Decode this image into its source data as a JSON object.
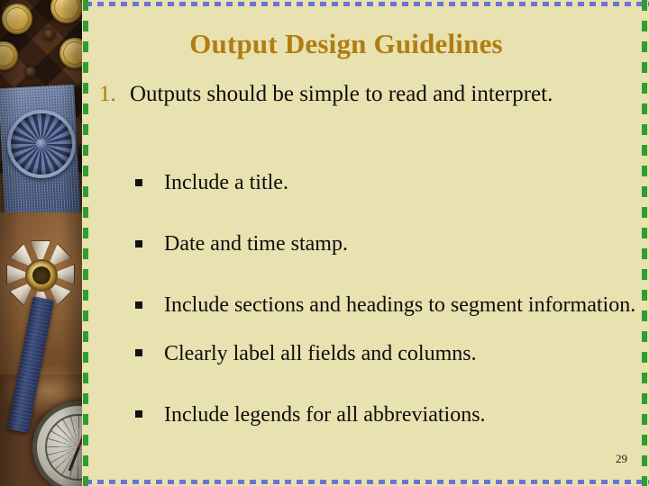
{
  "slide": {
    "title": "Output Design Guidelines",
    "page_number": "29",
    "background_color": "#e8e1b0",
    "title_color": "#b07d11",
    "border_top_color": "#6b72d8",
    "border_bottom_color": "#6b72d8",
    "border_left_color": "#2f9e32",
    "border_right_color": "#2f9e32"
  },
  "numbered_list": [
    {
      "marker": "1.",
      "text": "Outputs should be simple to read and interpret."
    }
  ],
  "bullets": [
    {
      "marker": "▪",
      "text": "Include a title."
    },
    {
      "marker": "▪",
      "text": "Date and time stamp."
    },
    {
      "marker": "▪",
      "text": "Include sections and headings to segment information."
    },
    {
      "marker": "▪",
      "text": "Clearly label all fields and columns."
    },
    {
      "marker": "▪",
      "text": "Include legends for all abbreviations."
    }
  ],
  "decorative_image": {
    "description": "photograph of military medals, gold coins, blue ribbon and a compass on a dark wooden board"
  }
}
